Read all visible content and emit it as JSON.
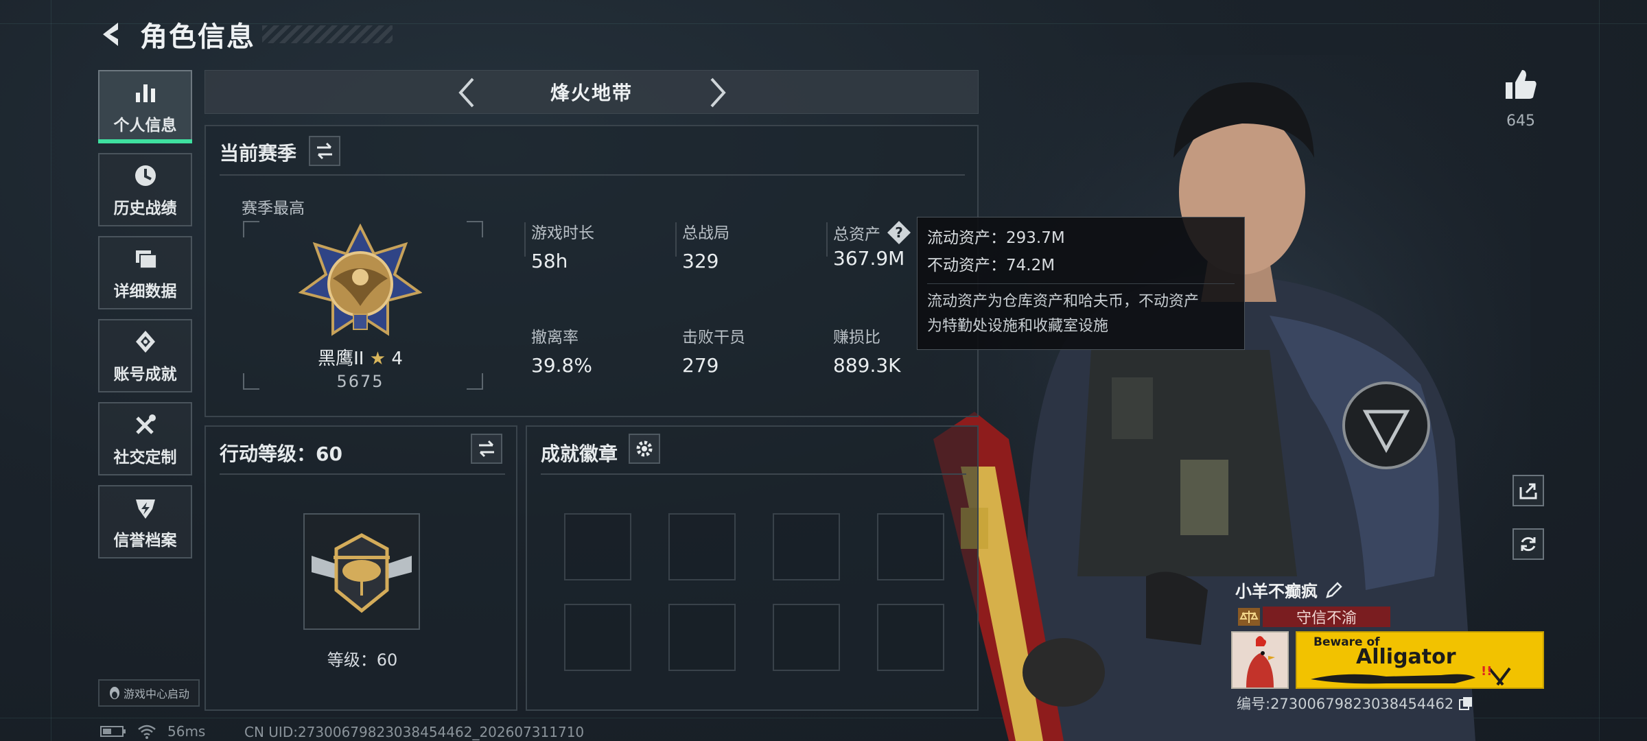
{
  "header": {
    "title": "角色信息"
  },
  "sidebar": {
    "items": [
      {
        "label": "个人信息",
        "icon": "bar-chart-icon",
        "active": true
      },
      {
        "label": "历史战绩",
        "icon": "clock-icon",
        "active": false
      },
      {
        "label": "详细数据",
        "icon": "folder-icon",
        "active": false
      },
      {
        "label": "账号成就",
        "icon": "achievement-icon",
        "active": false
      },
      {
        "label": "社交定制",
        "icon": "wrench-icon",
        "active": false
      },
      {
        "label": "信誉档案",
        "icon": "lightning-shield-icon",
        "active": false
      }
    ]
  },
  "mode": {
    "title": "烽火地带"
  },
  "season": {
    "title": "当前赛季",
    "best_label": "赛季最高",
    "rank_name": "黑鹰II",
    "rank_stars": "4",
    "rank_score": "5675",
    "stats": [
      {
        "label": "游戏时长",
        "value": "58h"
      },
      {
        "label": "总战局",
        "value": "329"
      },
      {
        "label": "总资产",
        "value": "367.9M"
      },
      {
        "label": "撤离率",
        "value": "39.8%"
      },
      {
        "label": "击败干员",
        "value": "279"
      },
      {
        "label": "赚损比",
        "value": "889.3K"
      }
    ]
  },
  "tooltip": {
    "liquid": "流动资产：293.7M",
    "fixed": "不动资产：74.2M",
    "desc_line1": "流动资产为仓库资产和哈夫币，不动资产",
    "desc_line2": "为特勤处设施和收藏室设施"
  },
  "action_level": {
    "title": "行动等级：60",
    "level_text": "等级：60"
  },
  "achievements": {
    "title": "成就徽章",
    "slots": 8
  },
  "likes": {
    "count": "645"
  },
  "player": {
    "name": "小羊不癫疯",
    "title_tag": "守信不渝",
    "banner_small": "Beware of",
    "banner_big": "Alligator",
    "id_text": "编号:27300679823038454462"
  },
  "footer": {
    "launch": "游戏中心启动",
    "ping": "56ms",
    "uid": "CN UID:27300679823038454462_202607311710"
  },
  "colors": {
    "accent_green": "#3fe0a0",
    "tag_red": "#7a1d20",
    "banner_yellow": "#f2c200"
  }
}
